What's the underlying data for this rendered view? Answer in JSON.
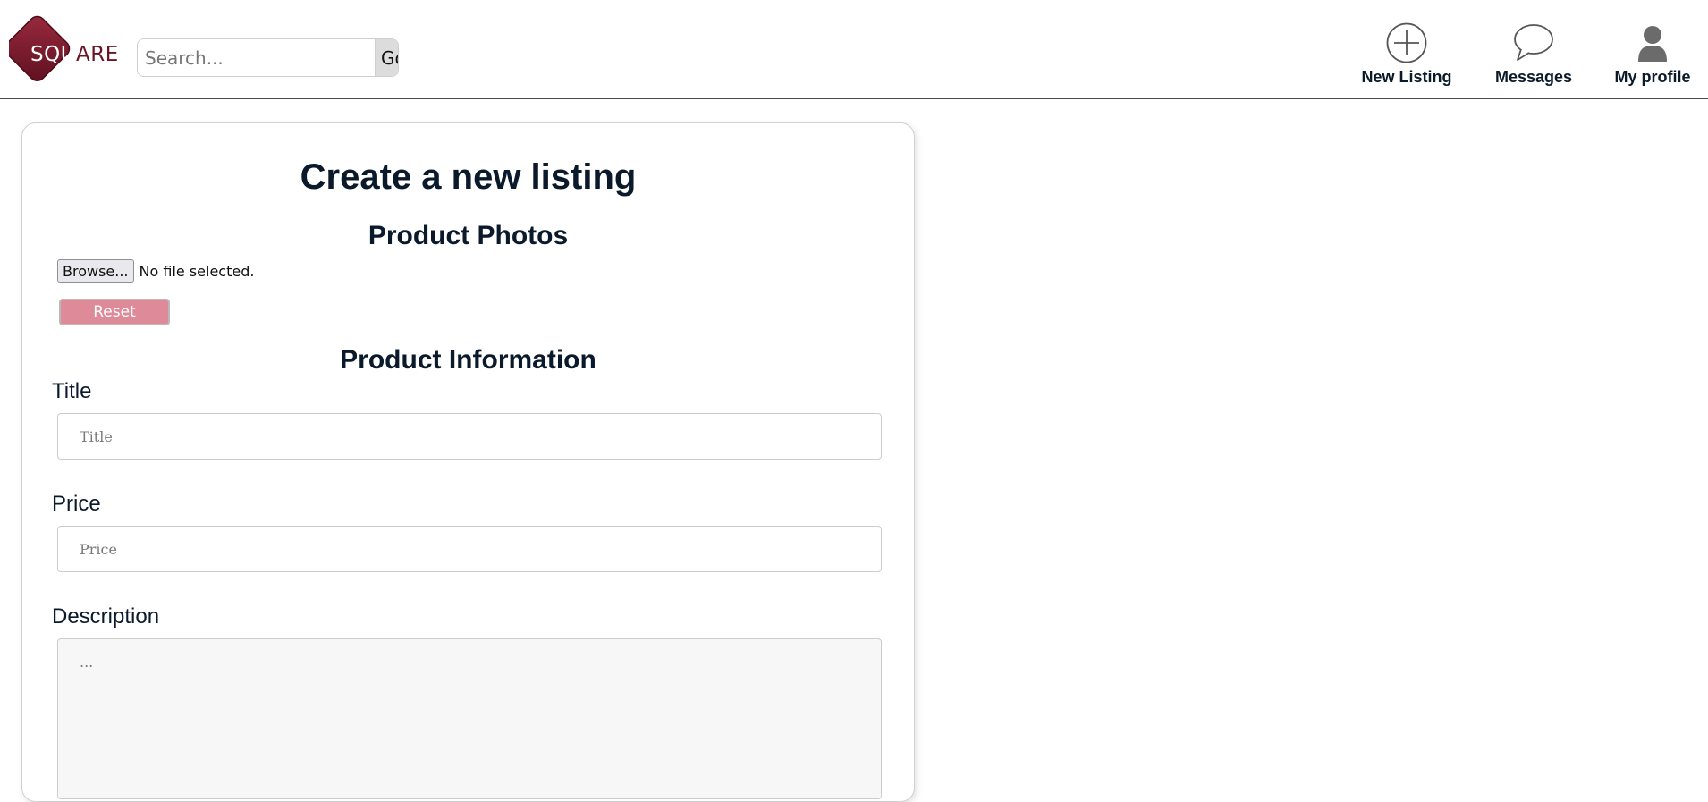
{
  "header": {
    "logo_text": "SQU",
    "logo_text_tail": "ARE",
    "search": {
      "placeholder": "Search...",
      "button_label": "Go"
    },
    "nav": [
      {
        "label": "New Listing",
        "icon": "plus-circle-icon"
      },
      {
        "label": "Messages",
        "icon": "speech-bubble-icon"
      },
      {
        "label": "My profile",
        "icon": "user-icon"
      }
    ]
  },
  "form": {
    "title": "Create a new listing",
    "photos_heading": "Product Photos",
    "browse_label": "Browse...",
    "file_status": "No file selected.",
    "reset_label": "Reset",
    "info_heading": "Product Information",
    "title_label": "Title",
    "title_placeholder": "Title",
    "price_label": "Price",
    "price_placeholder": "Price",
    "description_label": "Description",
    "description_placeholder": "..."
  },
  "colors": {
    "brand": "#7a1a2e",
    "reset_button": "#de8a98",
    "text": "#0b1a2b"
  }
}
